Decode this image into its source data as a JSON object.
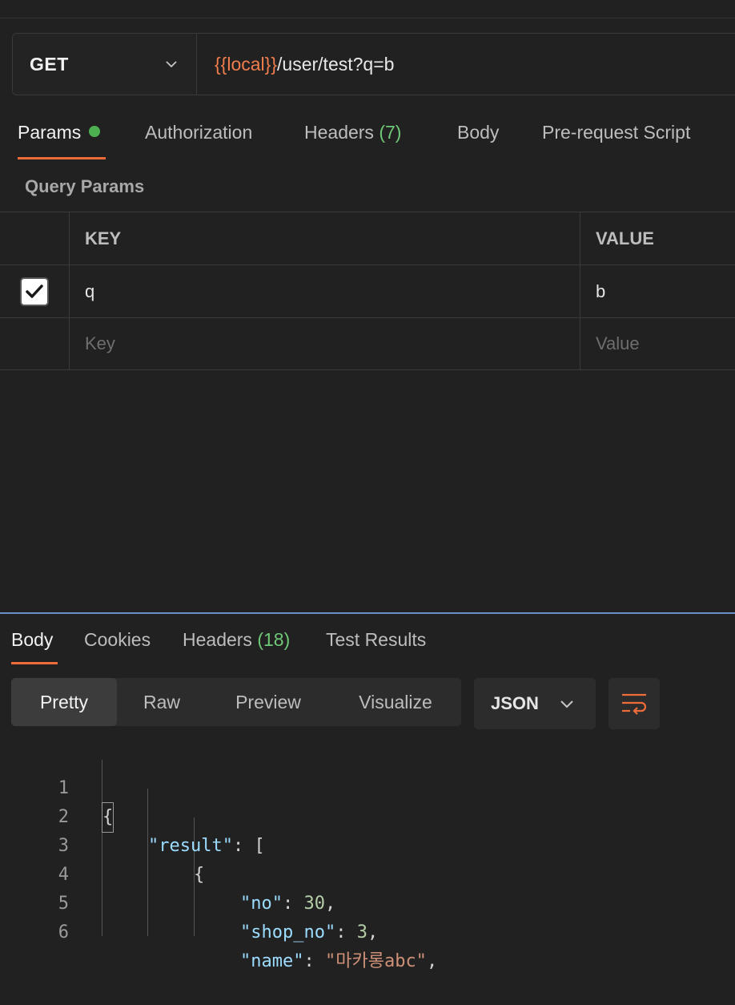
{
  "request": {
    "method": "GET",
    "url_var": "{{local}}",
    "url_path": "/user/test?q=b"
  },
  "request_tabs": [
    {
      "label": "Params",
      "has_dot": true
    },
    {
      "label": "Authorization"
    },
    {
      "label": "Headers ",
      "count": "(7)"
    },
    {
      "label": "Body"
    },
    {
      "label": "Pre-request Script"
    }
  ],
  "params": {
    "section_title": "Query Params",
    "header_key": "KEY",
    "header_value": "VALUE",
    "row": {
      "checked": true,
      "key": "q",
      "value": "b"
    },
    "placeholder_key": "Key",
    "placeholder_value": "Value"
  },
  "response_tabs": [
    {
      "label": "Body"
    },
    {
      "label": "Cookies"
    },
    {
      "label": "Headers ",
      "count": "(18)"
    },
    {
      "label": "Test Results"
    }
  ],
  "view_modes": [
    "Pretty",
    "Raw",
    "Preview",
    "Visualize"
  ],
  "format": "JSON",
  "icons": {
    "method_dropdown": "chevron-down-icon",
    "format_dropdown": "chevron-down-icon",
    "wrap": "wrap-lines-icon",
    "checkbox": "check-icon"
  },
  "colors": {
    "accent": "#ef6c3a",
    "variable": "#ef7d4d",
    "count": "#6fc877",
    "dot": "#4caf50",
    "json_key": "#9cdcfe",
    "json_string": "#ce9178",
    "json_number": "#b5cea8"
  },
  "code_lines": [
    {
      "no": "1"
    },
    {
      "no": "2",
      "key": "\"result\"",
      "punct": ": ["
    },
    {
      "no": "3",
      "text": "{"
    },
    {
      "no": "4",
      "key": "\"no\"",
      "sep": ": ",
      "num": "30",
      "end": ","
    },
    {
      "no": "5",
      "key": "\"shop_no\"",
      "sep": ": ",
      "num": "3",
      "end": ","
    },
    {
      "no": "6",
      "key": "\"name\"",
      "sep": ": ",
      "str": "\"마카롱abc\"",
      "end": ","
    }
  ],
  "brace_open": "{"
}
